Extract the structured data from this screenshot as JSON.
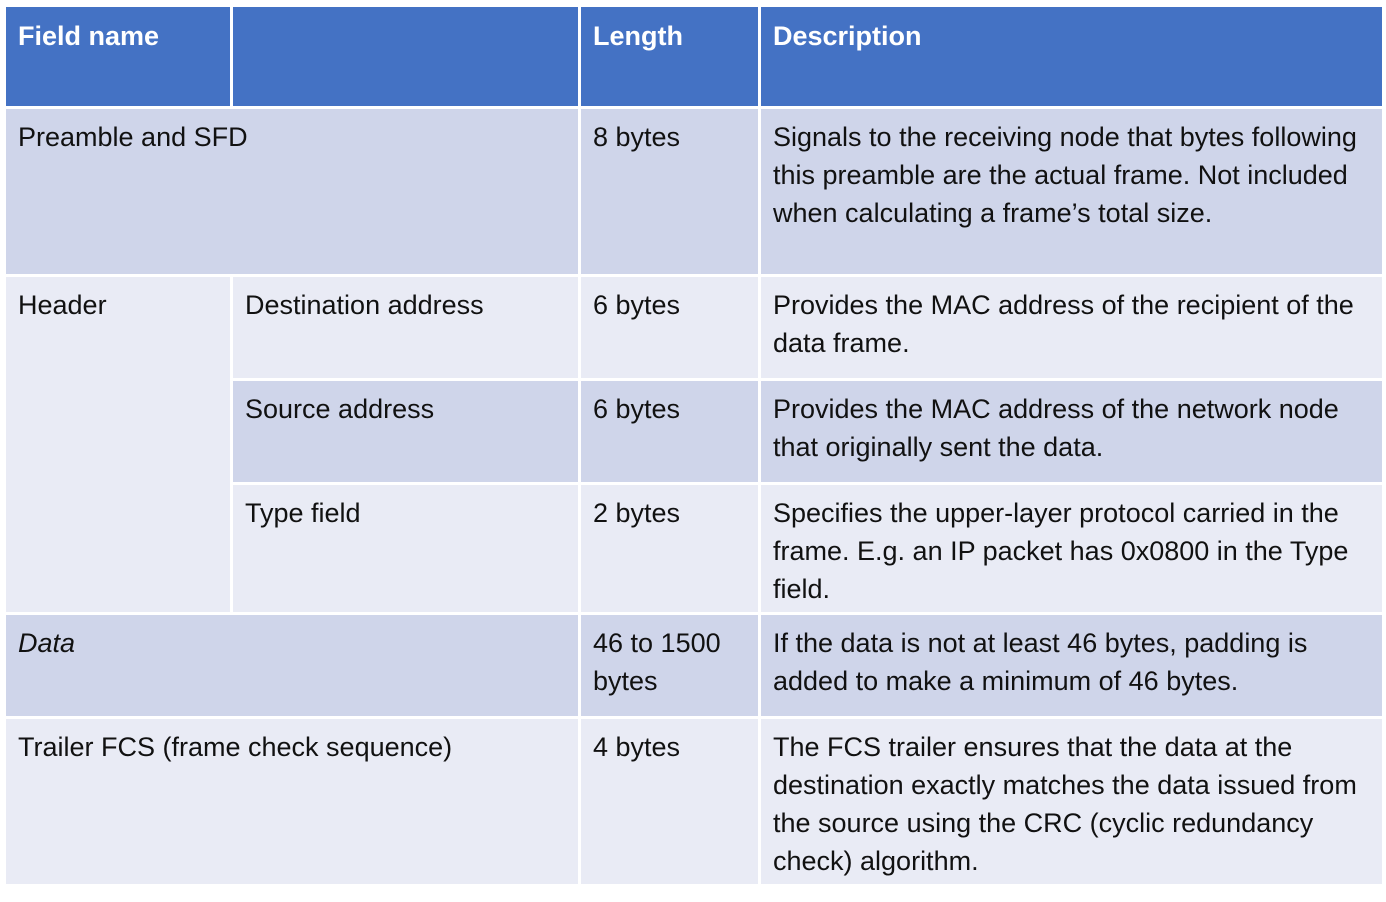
{
  "table": {
    "headers": {
      "field_name": "Field name",
      "subfield": "",
      "length": "Length",
      "description": "Description"
    },
    "rows": {
      "preamble": {
        "field": "Preamble and SFD",
        "length": "8 bytes",
        "description": "Signals to the receiving node that bytes following this preamble are the actual frame. Not included when calculating a frame’s total size."
      },
      "header": {
        "field": "Header",
        "destination": {
          "subfield": "Destination address",
          "length": "6 bytes",
          "description": "Provides the MAC address of the recipient of the data frame."
        },
        "source": {
          "subfield": "Source address",
          "length": "6 bytes",
          "description": "Provides the MAC address of the network node that originally sent the data."
        },
        "type": {
          "subfield": "Type field",
          "length": "2 bytes",
          "description": "Specifies the upper-layer protocol carried in the frame. E.g. an IP packet has 0x0800 in the Type field."
        }
      },
      "data": {
        "field": "Data",
        "length": "46 to 1500 bytes",
        "description": "If the data is not at least 46 bytes, padding is added to make a minimum of 46 bytes."
      },
      "trailer": {
        "field": "Trailer FCS (frame check sequence)",
        "length": "4 bytes",
        "description": "The FCS trailer ensures that the data at the destination exactly matches the data issued from the source using the CRC (cyclic redundancy check) algorithm."
      }
    }
  },
  "colors": {
    "header_bg": "#4472c4",
    "band_dark": "#cfd5ea",
    "band_light": "#e9ebf5"
  }
}
